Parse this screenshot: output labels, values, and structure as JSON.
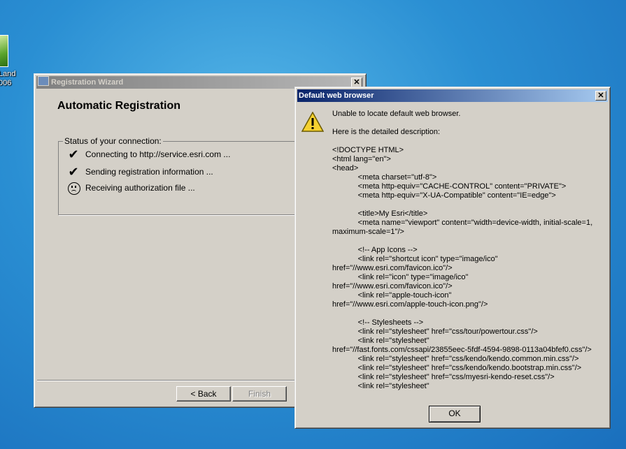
{
  "desktop": {
    "icon_label": "Land\n006"
  },
  "wizard": {
    "title": "Registration Wizard",
    "close_glyph": "✕",
    "heading": "Automatic Registration",
    "group_label": "Status of your connection:",
    "steps": [
      {
        "label": "Connecting to http://service.esri.com ...",
        "status": "done",
        "icon": "check-icon"
      },
      {
        "label": "Sending registration information ...",
        "status": "done",
        "icon": "check-icon"
      },
      {
        "label": "Receiving authorization file ...",
        "status": "failed",
        "icon": "sad-face-icon"
      }
    ],
    "back_label": "< Back",
    "finish_label": "Finish"
  },
  "dialog": {
    "title": "Default web browser",
    "close_glyph": "✕",
    "message": "Unable to locate default web browser.",
    "detail_intro": "Here is the detailed description:",
    "detail_lines": [
      "<!DOCTYPE HTML>",
      "<html lang=\"en\">",
      "<head>",
      "            <meta charset=\"utf-8\">",
      "            <meta http-equiv=\"CACHE-CONTROL\" content=\"PRIVATE\">",
      "            <meta http-equiv=\"X-UA-Compatible\" content=\"IE=edge\">",
      "",
      "            <title>My Esri</title>",
      "            <meta name=\"viewport\" content=\"width=device-width, initial-scale=1,",
      "maximum-scale=1\"/>",
      "",
      "            <!-- App Icons -->",
      "            <link rel=\"shortcut icon\" type=\"image/ico\"",
      "href=\"//www.esri.com/favicon.ico\"/>",
      "            <link rel=\"icon\" type=\"image/ico\"",
      "href=\"//www.esri.com/favicon.ico\"/>",
      "            <link rel=\"apple-touch-icon\"",
      "href=\"//www.esri.com/apple-touch-icon.png\"/>",
      "",
      "            <!-- Stylesheets -->",
      "            <link rel=\"stylesheet\" href=\"css/tour/powertour.css\"/>",
      "            <link rel=\"stylesheet\"",
      "href=\"//fast.fonts.com/cssapi/23855eec-5fdf-4594-9898-0113a04bfef0.css\"/>",
      "            <link rel=\"stylesheet\" href=\"css/kendo/kendo.common.min.css\"/>",
      "            <link rel=\"stylesheet\" href=\"css/kendo/kendo.bootstrap.min.css\"/>",
      "            <link rel=\"stylesheet\" href=\"css/myesri-kendo-reset.css\"/>",
      "            <link rel=\"stylesheet\""
    ],
    "ok_label": "OK"
  },
  "colors": {
    "active_title_start": "#0a246a",
    "active_title_end": "#a6caf0",
    "inactive_title": "#808080",
    "dialog_face": "#d4d0c8",
    "desktop": "#2a8fd3"
  }
}
